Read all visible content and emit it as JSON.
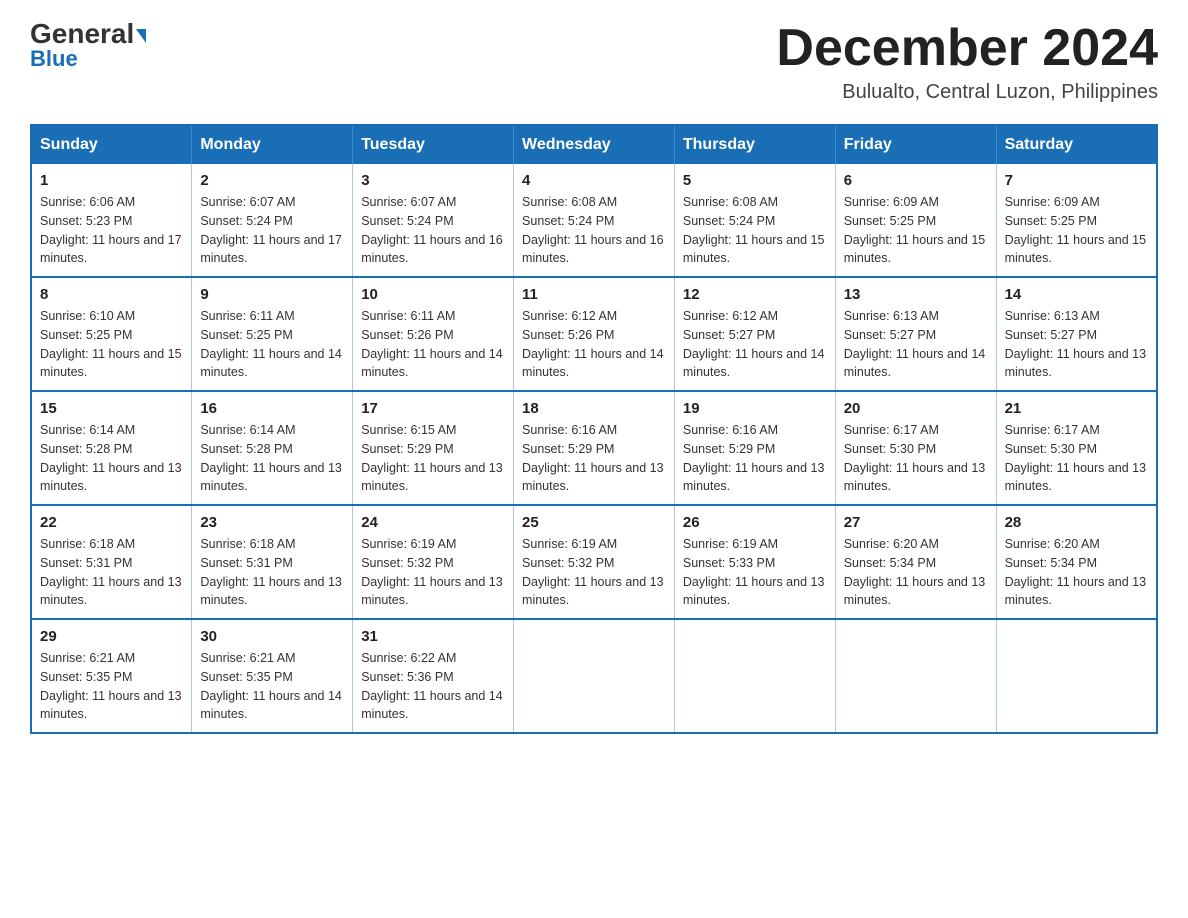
{
  "logo": {
    "general": "General",
    "blue": "Blue"
  },
  "header": {
    "month": "December 2024",
    "location": "Bulualto, Central Luzon, Philippines"
  },
  "days_of_week": [
    "Sunday",
    "Monday",
    "Tuesday",
    "Wednesday",
    "Thursday",
    "Friday",
    "Saturday"
  ],
  "weeks": [
    [
      {
        "day": "1",
        "sunrise": "6:06 AM",
        "sunset": "5:23 PM",
        "daylight": "11 hours and 17 minutes."
      },
      {
        "day": "2",
        "sunrise": "6:07 AM",
        "sunset": "5:24 PM",
        "daylight": "11 hours and 17 minutes."
      },
      {
        "day": "3",
        "sunrise": "6:07 AM",
        "sunset": "5:24 PM",
        "daylight": "11 hours and 16 minutes."
      },
      {
        "day": "4",
        "sunrise": "6:08 AM",
        "sunset": "5:24 PM",
        "daylight": "11 hours and 16 minutes."
      },
      {
        "day": "5",
        "sunrise": "6:08 AM",
        "sunset": "5:24 PM",
        "daylight": "11 hours and 15 minutes."
      },
      {
        "day": "6",
        "sunrise": "6:09 AM",
        "sunset": "5:25 PM",
        "daylight": "11 hours and 15 minutes."
      },
      {
        "day": "7",
        "sunrise": "6:09 AM",
        "sunset": "5:25 PM",
        "daylight": "11 hours and 15 minutes."
      }
    ],
    [
      {
        "day": "8",
        "sunrise": "6:10 AM",
        "sunset": "5:25 PM",
        "daylight": "11 hours and 15 minutes."
      },
      {
        "day": "9",
        "sunrise": "6:11 AM",
        "sunset": "5:25 PM",
        "daylight": "11 hours and 14 minutes."
      },
      {
        "day": "10",
        "sunrise": "6:11 AM",
        "sunset": "5:26 PM",
        "daylight": "11 hours and 14 minutes."
      },
      {
        "day": "11",
        "sunrise": "6:12 AM",
        "sunset": "5:26 PM",
        "daylight": "11 hours and 14 minutes."
      },
      {
        "day": "12",
        "sunrise": "6:12 AM",
        "sunset": "5:27 PM",
        "daylight": "11 hours and 14 minutes."
      },
      {
        "day": "13",
        "sunrise": "6:13 AM",
        "sunset": "5:27 PM",
        "daylight": "11 hours and 14 minutes."
      },
      {
        "day": "14",
        "sunrise": "6:13 AM",
        "sunset": "5:27 PM",
        "daylight": "11 hours and 13 minutes."
      }
    ],
    [
      {
        "day": "15",
        "sunrise": "6:14 AM",
        "sunset": "5:28 PM",
        "daylight": "11 hours and 13 minutes."
      },
      {
        "day": "16",
        "sunrise": "6:14 AM",
        "sunset": "5:28 PM",
        "daylight": "11 hours and 13 minutes."
      },
      {
        "day": "17",
        "sunrise": "6:15 AM",
        "sunset": "5:29 PM",
        "daylight": "11 hours and 13 minutes."
      },
      {
        "day": "18",
        "sunrise": "6:16 AM",
        "sunset": "5:29 PM",
        "daylight": "11 hours and 13 minutes."
      },
      {
        "day": "19",
        "sunrise": "6:16 AM",
        "sunset": "5:29 PM",
        "daylight": "11 hours and 13 minutes."
      },
      {
        "day": "20",
        "sunrise": "6:17 AM",
        "sunset": "5:30 PM",
        "daylight": "11 hours and 13 minutes."
      },
      {
        "day": "21",
        "sunrise": "6:17 AM",
        "sunset": "5:30 PM",
        "daylight": "11 hours and 13 minutes."
      }
    ],
    [
      {
        "day": "22",
        "sunrise": "6:18 AM",
        "sunset": "5:31 PM",
        "daylight": "11 hours and 13 minutes."
      },
      {
        "day": "23",
        "sunrise": "6:18 AM",
        "sunset": "5:31 PM",
        "daylight": "11 hours and 13 minutes."
      },
      {
        "day": "24",
        "sunrise": "6:19 AM",
        "sunset": "5:32 PM",
        "daylight": "11 hours and 13 minutes."
      },
      {
        "day": "25",
        "sunrise": "6:19 AM",
        "sunset": "5:32 PM",
        "daylight": "11 hours and 13 minutes."
      },
      {
        "day": "26",
        "sunrise": "6:19 AM",
        "sunset": "5:33 PM",
        "daylight": "11 hours and 13 minutes."
      },
      {
        "day": "27",
        "sunrise": "6:20 AM",
        "sunset": "5:34 PM",
        "daylight": "11 hours and 13 minutes."
      },
      {
        "day": "28",
        "sunrise": "6:20 AM",
        "sunset": "5:34 PM",
        "daylight": "11 hours and 13 minutes."
      }
    ],
    [
      {
        "day": "29",
        "sunrise": "6:21 AM",
        "sunset": "5:35 PM",
        "daylight": "11 hours and 13 minutes."
      },
      {
        "day": "30",
        "sunrise": "6:21 AM",
        "sunset": "5:35 PM",
        "daylight": "11 hours and 14 minutes."
      },
      {
        "day": "31",
        "sunrise": "6:22 AM",
        "sunset": "5:36 PM",
        "daylight": "11 hours and 14 minutes."
      },
      null,
      null,
      null,
      null
    ]
  ]
}
